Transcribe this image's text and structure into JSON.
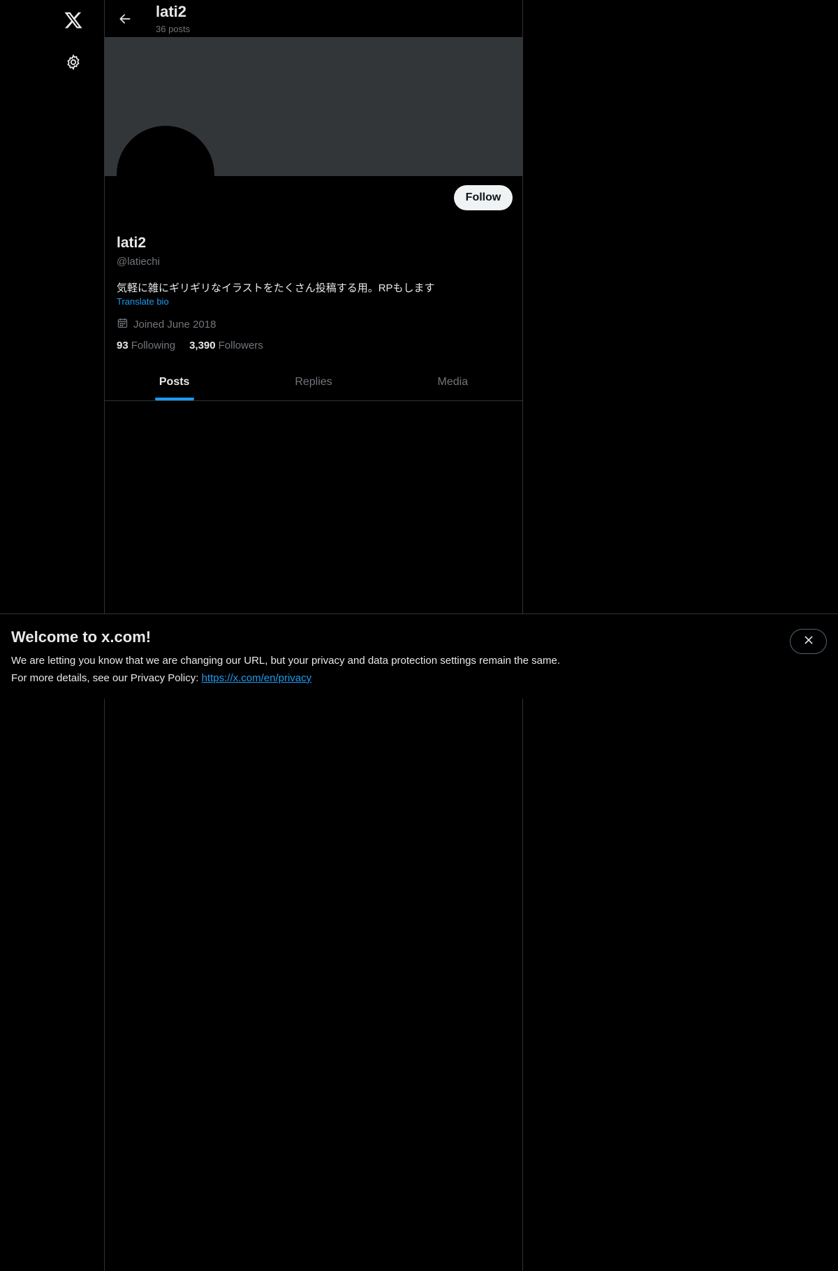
{
  "rail": {
    "logo_icon": "x-logo-icon",
    "settings_icon": "gear-icon"
  },
  "topbar": {
    "name": "lati2",
    "posts_count": "36 posts"
  },
  "profile": {
    "follow_label": "Follow",
    "name": "lati2",
    "handle": "@latiechi",
    "bio": "気軽に雑にギリギリなイラストをたくさん投稿する用。RPもします",
    "translate_label": "Translate bio",
    "joined": "Joined June 2018",
    "following_count": "93",
    "following_label": "Following",
    "followers_count": "3,390",
    "followers_label": "Followers"
  },
  "tabs": [
    {
      "label": "Posts",
      "active": true
    },
    {
      "label": "Replies",
      "active": false
    },
    {
      "label": "Media",
      "active": false
    }
  ],
  "welcome": {
    "title": "Welcome to x.com!",
    "line1": "We are letting you know that we are changing our URL, but your privacy and data protection settings remain the same.",
    "line2_prefix": "For more details, see our Privacy Policy: ",
    "link": "https://x.com/en/privacy"
  },
  "colors": {
    "background": "#000000",
    "banner": "#333639",
    "accent": "#1d9bf0",
    "muted_text": "#71767b",
    "text": "#e7e9ea",
    "border": "#2f3336"
  }
}
